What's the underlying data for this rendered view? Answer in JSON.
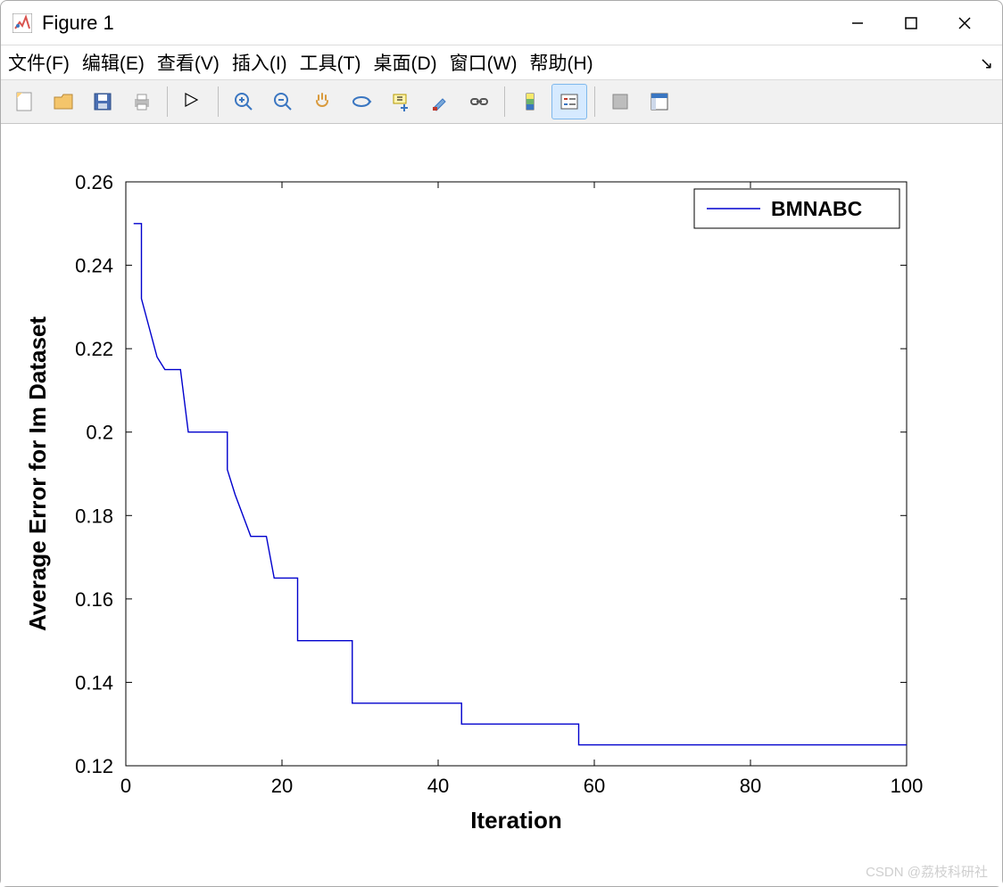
{
  "window": {
    "title": "Figure 1"
  },
  "menu": {
    "file": "文件(F)",
    "edit": "编辑(E)",
    "view": "查看(V)",
    "insert": "插入(I)",
    "tools": "工具(T)",
    "desktop": "桌面(D)",
    "window": "窗口(W)",
    "help": "帮助(H)"
  },
  "watermark": "CSDN @荔枝科研社",
  "colors": {
    "line": "#0000cd",
    "axis": "#000000",
    "tick": "#000000"
  },
  "chart_data": {
    "type": "line",
    "title": "",
    "xlabel": "Iteration",
    "ylabel": "Average Error for Im Dataset",
    "xlim": [
      0,
      100
    ],
    "ylim": [
      0.12,
      0.26
    ],
    "xticks": [
      0,
      20,
      40,
      60,
      80,
      100
    ],
    "yticks": [
      0.12,
      0.14,
      0.16,
      0.18,
      0.2,
      0.22,
      0.24,
      0.26
    ],
    "grid": false,
    "legend": {
      "position": "upper-right",
      "entries": [
        "BMNABC"
      ]
    },
    "series": [
      {
        "name": "BMNABC",
        "x": [
          1,
          2,
          2,
          3,
          4,
          5,
          5,
          6,
          7,
          8,
          9,
          10,
          11,
          12,
          13,
          13,
          14,
          15,
          16,
          16,
          17,
          18,
          19,
          20,
          21,
          22,
          22,
          23,
          25,
          27,
          29,
          29,
          30,
          34,
          38,
          42,
          43,
          43,
          46,
          50,
          54,
          58,
          58,
          60,
          70,
          80,
          90,
          100
        ],
        "y": [
          0.25,
          0.25,
          0.232,
          0.225,
          0.218,
          0.215,
          0.215,
          0.215,
          0.215,
          0.2,
          0.2,
          0.2,
          0.2,
          0.2,
          0.2,
          0.191,
          0.185,
          0.18,
          0.175,
          0.175,
          0.175,
          0.175,
          0.165,
          0.165,
          0.165,
          0.165,
          0.15,
          0.15,
          0.15,
          0.15,
          0.15,
          0.135,
          0.135,
          0.135,
          0.135,
          0.135,
          0.135,
          0.13,
          0.13,
          0.13,
          0.13,
          0.13,
          0.125,
          0.125,
          0.125,
          0.125,
          0.125,
          0.125
        ]
      }
    ]
  }
}
